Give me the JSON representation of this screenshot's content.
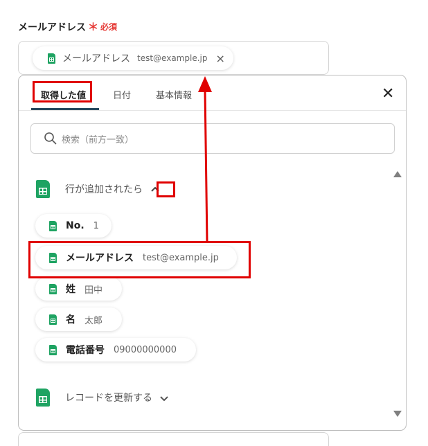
{
  "field": {
    "label": "メールアドレス",
    "required_mark": "＊",
    "required_text": "必須"
  },
  "selected_chip": {
    "name": "メールアドレス",
    "value": "test@example.jp",
    "remove_icon": "×"
  },
  "panel": {
    "tabs": [
      {
        "label": "取得した値",
        "active": true
      },
      {
        "label": "日付",
        "active": false
      },
      {
        "label": "基本情報",
        "active": false
      }
    ],
    "close_icon": "✕",
    "search_placeholder": "検索（前方一致）",
    "sections": [
      {
        "title": "行が追加されたら",
        "expanded": true,
        "items": [
          {
            "name": "No.",
            "value": "1"
          },
          {
            "name": "メールアドレス",
            "value": "test@example.jp"
          },
          {
            "name": "姓",
            "value": "田中"
          },
          {
            "name": "名",
            "value": "太郎"
          },
          {
            "name": "電話番号",
            "value": "09000000000"
          }
        ]
      },
      {
        "title": "レコードを更新する",
        "expanded": false
      }
    ]
  },
  "colors": {
    "highlight": "#e00000",
    "accent_tab": "#26495e",
    "sheet_green": "#1ea362",
    "required": "#e53935"
  }
}
